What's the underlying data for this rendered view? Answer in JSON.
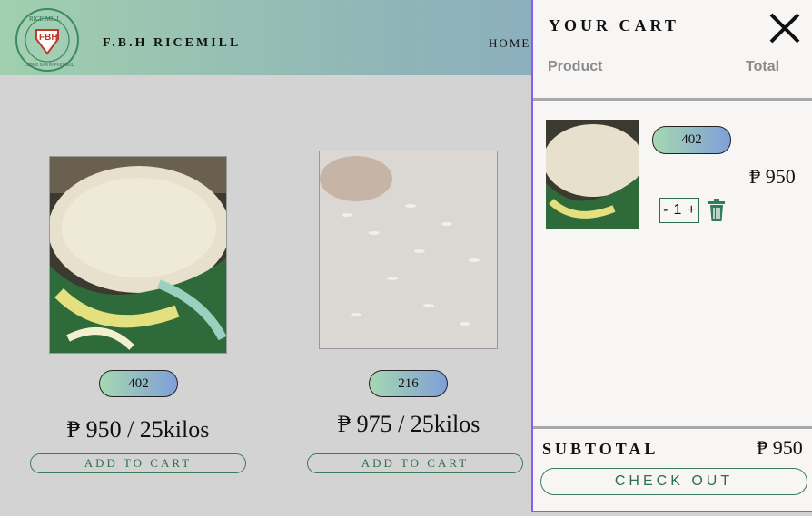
{
  "header": {
    "logo_top_text": "RICE MILL",
    "logo_initials": "FBH",
    "logo_bottom_text": "LLONG SAN RAFAEL BUL",
    "brand": "F.B.H RICEMILL",
    "nav_home": "HOME",
    "gradient": [
      "#a0cfae",
      "#86a6c8"
    ]
  },
  "products": [
    {
      "stock_badge": "402",
      "price": "₱ 950 / 25kilos",
      "add_label": "ADD TO CART",
      "image": "rice-sack-photo"
    },
    {
      "stock_badge": "216",
      "price": "₱ 975 / 25kilos",
      "add_label": "ADD TO CART",
      "image": "rice-grains-closeup-photo"
    }
  ],
  "cart": {
    "title": "YOUR CART",
    "col_product": "Product",
    "col_total": "Total",
    "items": [
      {
        "stock_badge": "402",
        "price": "₱ 950",
        "qty_minus": "-",
        "qty": "1",
        "qty_plus": "+",
        "image": "rice-sack-photo"
      }
    ],
    "subtotal_label": "SUBTOTAL",
    "subtotal_value": "₱ 950",
    "checkout_label": "CHECK OUT",
    "accent": "#8a5cf6",
    "button_color": "#2f6e50"
  }
}
